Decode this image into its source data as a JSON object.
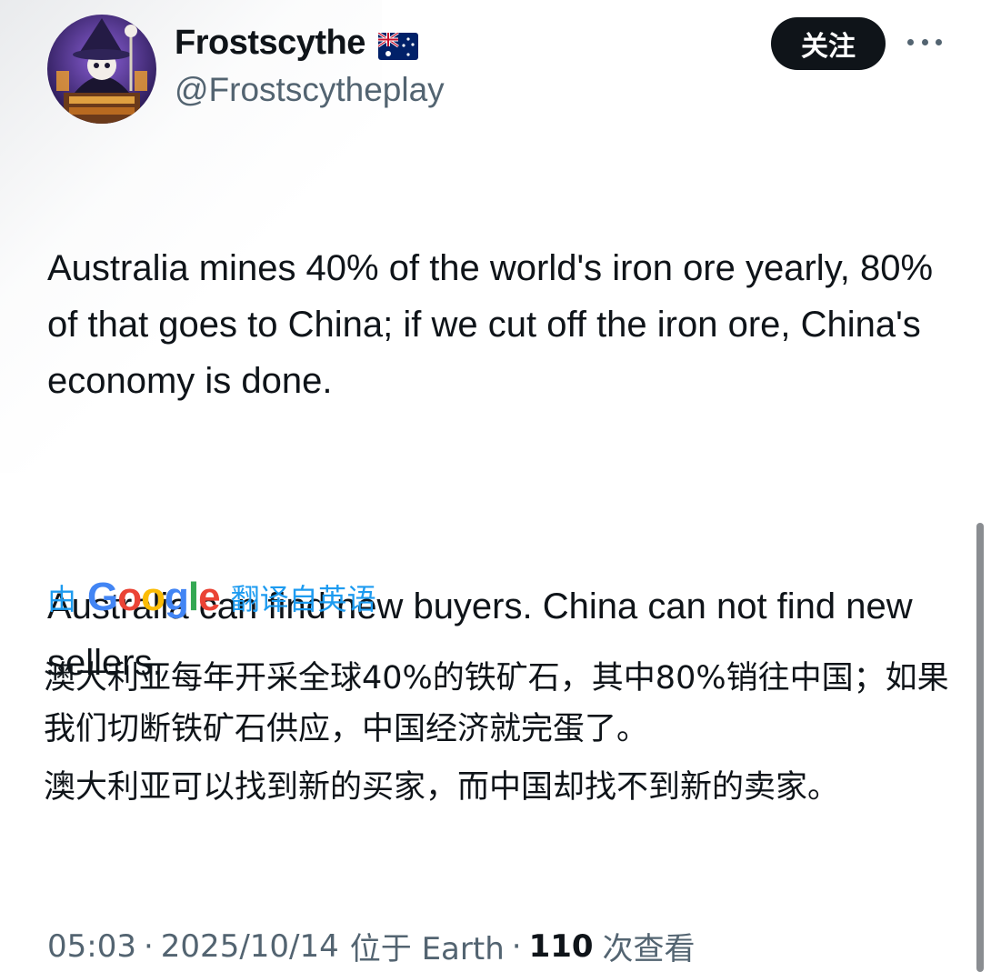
{
  "author": {
    "display_name": "Frostscythe",
    "flag": "australia-flag-icon",
    "handle": "@Frostscytheplay"
  },
  "actions": {
    "follow_label": "关注",
    "more_icon": "more-options-icon"
  },
  "tweet": {
    "paragraph_1": "Australia mines 40% of the world's iron ore yearly, 80% of that goes to China; if we cut off the iron ore, China's economy is done.",
    "paragraph_2": "Australia can find new buyers. China can not find new sellers."
  },
  "translation": {
    "prefix": "由",
    "provider": "Google",
    "suffix": "翻译自英语",
    "paragraph_1": "澳大利亚每年开采全球40%的铁矿石，其中80%销往中国；如果我们切断铁矿石供应，中国经济就完蛋了。",
    "paragraph_2": "澳大利亚可以找到新的买家，而中国却找不到新的卖家。"
  },
  "meta": {
    "time": "05:03",
    "separator": "·",
    "date": "2025/10/14",
    "location": "位于 Earth",
    "views_count": "110",
    "views_label": "次查看"
  },
  "colors": {
    "link_blue": "#1d9bf0",
    "follow_bg": "#0f1419",
    "secondary_text": "#536471"
  }
}
